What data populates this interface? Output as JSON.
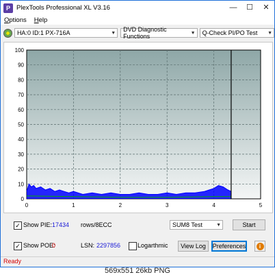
{
  "window": {
    "title": "PlexTools Professional XL V3.16",
    "icon_letter": "P",
    "controls": [
      "minimize-icon",
      "maximize-icon",
      "close-icon"
    ]
  },
  "menu": [
    {
      "label": "Options",
      "accel": "O",
      "rest": "ptions"
    },
    {
      "label": "Help",
      "accel": "H",
      "rest": "elp"
    }
  ],
  "toolbar": {
    "drive": "HA:0 ID:1  PX-716A",
    "function": "DVD Diagnostic Functions",
    "test": "Q-Check PI/PO Test"
  },
  "chart_data": {
    "type": "area",
    "xlim": [
      0,
      5
    ],
    "ylim": [
      0,
      100
    ],
    "x_ticks": [
      "0",
      "1",
      "2",
      "3",
      "4",
      "5"
    ],
    "y_ticks": [
      "100",
      "90",
      "80",
      "70",
      "60",
      "50",
      "40",
      "30",
      "20",
      "10",
      "0"
    ],
    "end_marker_x": 4.37,
    "grid": true,
    "series": [
      {
        "color": "#0000ff",
        "x": [
          0.0,
          0.05,
          0.1,
          0.15,
          0.2,
          0.3,
          0.4,
          0.5,
          0.6,
          0.7,
          0.8,
          0.9,
          1.0,
          1.2,
          1.4,
          1.6,
          1.8,
          2.0,
          2.2,
          2.4,
          2.6,
          2.8,
          3.0,
          3.2,
          3.4,
          3.6,
          3.8,
          3.9,
          4.0,
          4.1,
          4.2,
          4.3,
          4.37
        ],
        "y": [
          5,
          10,
          8,
          9,
          7,
          8,
          6,
          7,
          5,
          6,
          5,
          4,
          5,
          3,
          4,
          3,
          4,
          3,
          3,
          4,
          3,
          3,
          4,
          3,
          4,
          4,
          5,
          6,
          7,
          9,
          8,
          6,
          5
        ]
      },
      {
        "color": "#00aa00",
        "x": [
          0.0,
          1.0,
          2.0,
          3.0,
          4.0,
          4.37
        ],
        "y": [
          2,
          1.5,
          1,
          1,
          1.5,
          1.5
        ]
      }
    ]
  },
  "controls": {
    "show_pie_label": "Show PIE:",
    "show_pie_checked": "✓",
    "pie_value": "17434",
    "pie_unit": "rows/8ECC",
    "show_poe_label": "Show POE:",
    "show_poe_checked": "✓",
    "poe_value": "0",
    "lsn_label": "LSN:",
    "lsn_value": "2297856",
    "logarithmic_label": "Logarthmic",
    "test_mode": "SUM8 Test",
    "start_label": "Start",
    "view_log_label": "View Log",
    "preferences_label": "Preferences",
    "help_glyph": "i"
  },
  "status": "Ready",
  "caption": "569x551 26kb PNG"
}
